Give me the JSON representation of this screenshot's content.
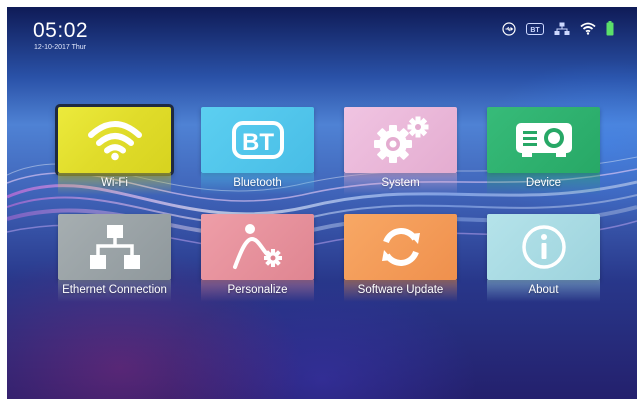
{
  "status_bar": {
    "time": "05:02",
    "date": "12-10-2017 Thur",
    "icons": [
      "usb-icon",
      "bluetooth-icon",
      "ethernet-icon",
      "wifi-icon",
      "battery-icon"
    ],
    "bt_badge": "BT"
  },
  "menu": {
    "selected": "Wi-Fi",
    "tiles": [
      {
        "label": "Wi-Fi",
        "icon": "wifi-icon",
        "color": "#e6e332"
      },
      {
        "label": "Bluetooth",
        "icon": "bluetooth-icon",
        "icon_text": "BT",
        "color": "#4fc3ea"
      },
      {
        "label": "System",
        "icon": "gears-icon",
        "color": "#eab8d9"
      },
      {
        "label": "Device",
        "icon": "projector-icon",
        "color": "#2fb070"
      },
      {
        "label": "Ethernet Connection",
        "icon": "network-icon",
        "color": "#9aa3a6"
      },
      {
        "label": "Personalize",
        "icon": "personalize-icon",
        "color": "#e7919c"
      },
      {
        "label": "Software Update",
        "icon": "update-icon",
        "color": "#f59b5a"
      },
      {
        "label": "About",
        "icon": "info-icon",
        "color": "#a8dbe4"
      }
    ]
  },
  "colors": {
    "background_top": "#0f1b57",
    "background_mid": "#4f82d4",
    "background_bottom": "#24206d",
    "selection_outline": "#1f2a40",
    "battery": "#5be06a"
  }
}
